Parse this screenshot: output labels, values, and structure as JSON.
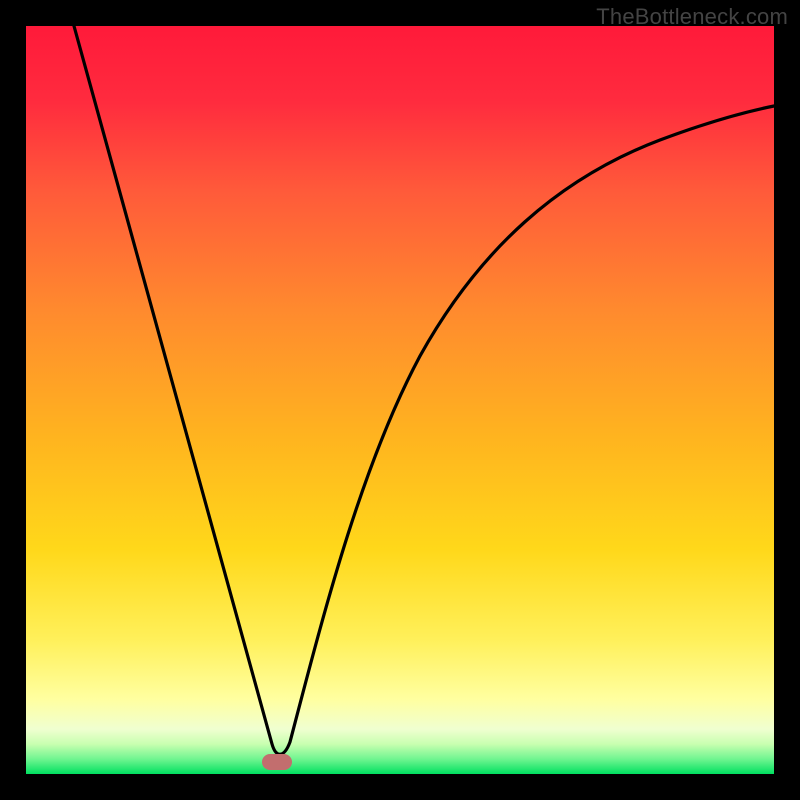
{
  "watermark": "TheBottleneck.com",
  "chart_data": {
    "type": "line",
    "title": "",
    "xlabel": "",
    "ylabel": "",
    "xlim": [
      0,
      100
    ],
    "ylim": [
      0,
      100
    ],
    "grid": false,
    "legend": false,
    "series": [
      {
        "name": "curve",
        "x": [
          0,
          5,
          10,
          15,
          20,
          25,
          30,
          32,
          33,
          35,
          40,
          45,
          50,
          55,
          60,
          65,
          70,
          75,
          80,
          85,
          90,
          95,
          100
        ],
        "y": [
          100,
          85,
          70,
          55,
          40,
          25,
          10,
          2,
          0,
          4,
          20,
          35,
          48,
          57,
          64,
          69,
          73,
          77,
          80,
          82,
          84,
          86,
          87
        ]
      }
    ],
    "valley_x": 33,
    "marker": {
      "x": 33,
      "y": 0,
      "color": "#b85858",
      "shape": "rounded-rect"
    },
    "background": {
      "type": "vertical-gradient",
      "stops": [
        {
          "offset": 0.0,
          "color": "#ff1744"
        },
        {
          "offset": 0.5,
          "color": "#ffb300"
        },
        {
          "offset": 0.75,
          "color": "#ffee58"
        },
        {
          "offset": 0.93,
          "color": "#ffff8d"
        },
        {
          "offset": 1.0,
          "color": "#00e676"
        }
      ]
    },
    "border_color": "#000000",
    "border_width_px": 26
  }
}
